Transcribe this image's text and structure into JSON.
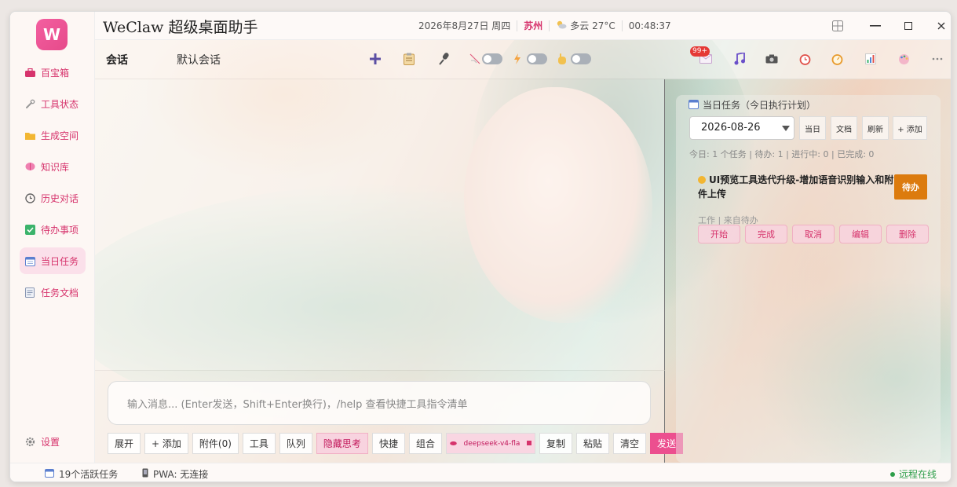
{
  "app": {
    "logo_letter": "W",
    "title": "WeClaw 超级桌面助手"
  },
  "statusbar_top": {
    "date": "2026年8月27日 周四",
    "city": "苏州",
    "weather": "多云 27°C",
    "time": "00:48:37"
  },
  "sidebar": {
    "items": [
      {
        "label": "百宝箱",
        "icon": "toolbox-icon"
      },
      {
        "label": "工具状态",
        "icon": "wrench-icon"
      },
      {
        "label": "生成空间",
        "icon": "folder-icon"
      },
      {
        "label": "知识库",
        "icon": "brain-icon"
      },
      {
        "label": "历史对话",
        "icon": "clock-icon"
      },
      {
        "label": "待办事项",
        "icon": "checkbox-icon"
      },
      {
        "label": "当日任务",
        "icon": "calendar-icon"
      },
      {
        "label": "任务文档",
        "icon": "document-icon"
      }
    ],
    "settings_label": "设置"
  },
  "toolbar": {
    "tab_active": "会话",
    "tab_default": "默认会话",
    "badge": "99+"
  },
  "composer": {
    "placeholder": "输入消息... (Enter发送，Shift+Enter换行)，/help 查看快捷工具指令清单",
    "buttons": [
      "展开",
      "+ 添加",
      "附件(0)",
      "工具",
      "队列",
      "隐藏思考",
      "快捷",
      "组合"
    ],
    "model": "deepseek-v4-fla",
    "after_buttons": [
      "复制",
      "粘贴",
      "清空"
    ],
    "send_label": "发送"
  },
  "tasks": {
    "title": "当日任务（今日执行计划）",
    "date": "2026-08-26",
    "buttons": [
      "当日",
      "文档",
      "刷新",
      "+ 添加"
    ],
    "summary": "今日: 1 个任务 | 待办: 1 | 进行中: 0 | 已完成: 0",
    "item": {
      "title": "UI预览工具迭代升级-增加语音识别输入和附件上传",
      "status": "待办",
      "meta": "工作 | 来自待办",
      "actions": [
        "开始",
        "完成",
        "取消",
        "编辑",
        "删除"
      ]
    }
  },
  "statusbar": {
    "active_tasks": "19个活跃任务",
    "pwa": "PWA: 无连接",
    "remote": "远程在线"
  },
  "colors": {
    "accent": "#ec4f8f",
    "status_pending": "#dc7b0e",
    "online": "#2e9e4a"
  }
}
